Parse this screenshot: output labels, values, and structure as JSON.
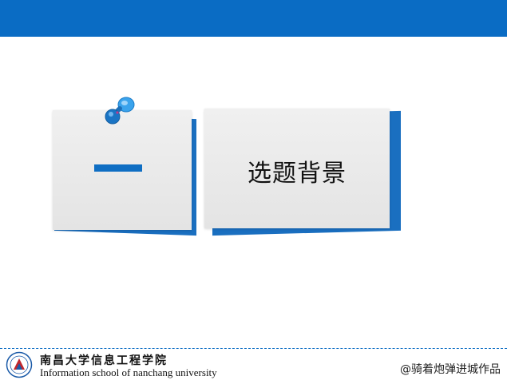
{
  "slide": {
    "top_bar_color": "#0a6cc4",
    "section_number": "一",
    "section_title": "选题背景"
  },
  "footer": {
    "school_name_cn": "南昌大学信息工程学院",
    "school_name_en": "Information school of  nanchang university",
    "credit": "@骑着炮弹进城作品",
    "logo_icon": "university-seal-icon"
  },
  "colors": {
    "accent": "#0a6cc4",
    "card_bg": "#e8e8e8",
    "pin": "#1e90e0"
  }
}
